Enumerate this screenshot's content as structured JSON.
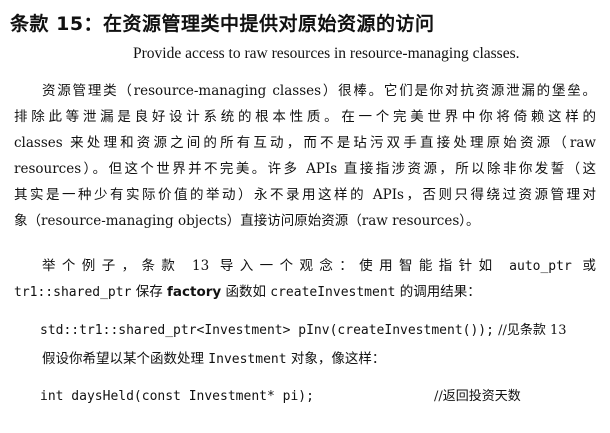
{
  "title": "条款 15：在资源管理类中提供对原始资源的访问",
  "subtitle": "Provide access to raw resources in resource-managing classes.",
  "paragraph1": [
    "资源管理类（resource-managing classes）很棒。它们是你对抗资源泄漏的堡垒。",
    "排除此等泄漏是良好设计系统的根本性质。在一个完美世界中你将倚赖这样的",
    "classes 来处理和资源之间的所有互动，而不是玷污双手直接处理原始资源（raw",
    "resources）。但这个世界并不完美。许多 APIs 直接指涉资源，所以除非你发誓（这",
    "其实是一种少有实际价值的举动）永不录用这样的 APIs，否则只得绕过资源管理对",
    "象（resource-managing objects）直接访问原始资源（raw resources）。"
  ],
  "paragraph2": {
    "line1": {
      "lead": "举个例子，条款 13 导入一个观念：使用智能指针如 ",
      "code": "auto_ptr",
      "tail": " 或"
    },
    "line2": {
      "code1": "tr1::shared_ptr",
      "text1": " 保存 ",
      "bold": "factory",
      "text2": " 函数如 ",
      "code2": "createInvestment",
      "text3": " 的调用结果："
    }
  },
  "code_sample_1": {
    "code": "std::tr1::shared_ptr<Investment> pInv(createInvestment());",
    "comment": " //见条款 13"
  },
  "paragraph3": {
    "lead": "假设你希望以某个函数处理 ",
    "code": "Investment",
    "tail": " 对象，像这样："
  },
  "code_sample_2": {
    "code": "int daysHeld(const Investment* pi);",
    "comment": "//返回投资天数"
  }
}
